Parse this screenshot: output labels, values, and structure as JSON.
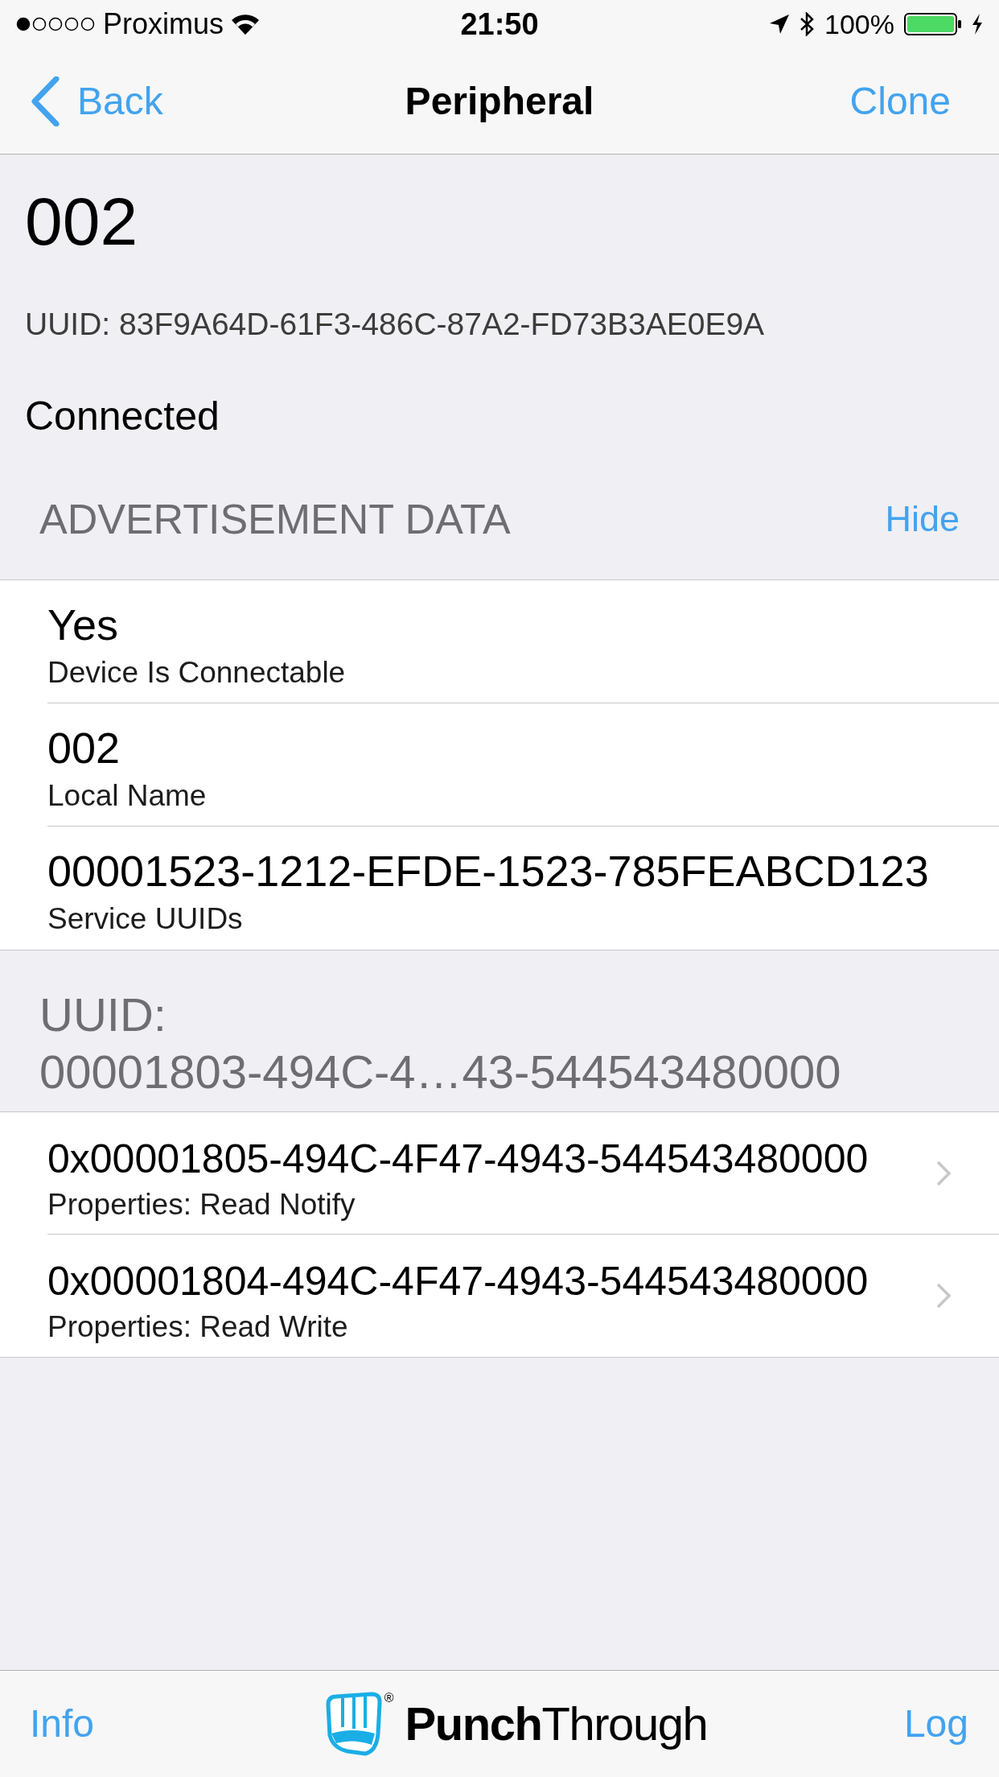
{
  "status_bar": {
    "carrier": "Proximus",
    "time": "21:50",
    "battery_percent": "100%"
  },
  "nav_bar": {
    "back": "Back",
    "title": "Peripheral",
    "action": "Clone"
  },
  "peripheral": {
    "name": "002",
    "uuid": "UUID: 83F9A64D-61F3-486C-87A2-FD73B3AE0E9A",
    "state": "Connected"
  },
  "advertisement": {
    "title": "ADVERTISEMENT DATA",
    "toggle": "Hide",
    "rows": [
      {
        "value": "Yes",
        "label": "Device Is Connectable"
      },
      {
        "value": "002",
        "label": "Local Name"
      },
      {
        "value": "00001523-1212-EFDE-1523-785FEABCD123",
        "label": "Service UUIDs"
      }
    ]
  },
  "service": {
    "title_lines": [
      "UUID:",
      "00001803-494C-4…43-544543480000"
    ],
    "characteristics": [
      {
        "uuid": "0x00001805-494C-4F47-4943-544543480000",
        "properties": "Properties: Read Notify"
      },
      {
        "uuid": "0x00001804-494C-4F47-4943-544543480000",
        "properties": "Properties: Read Write"
      }
    ]
  },
  "toolbar": {
    "left": "Info",
    "logo_text": "**Punch**Through",
    "logo_mark": "®",
    "right": "Log"
  }
}
